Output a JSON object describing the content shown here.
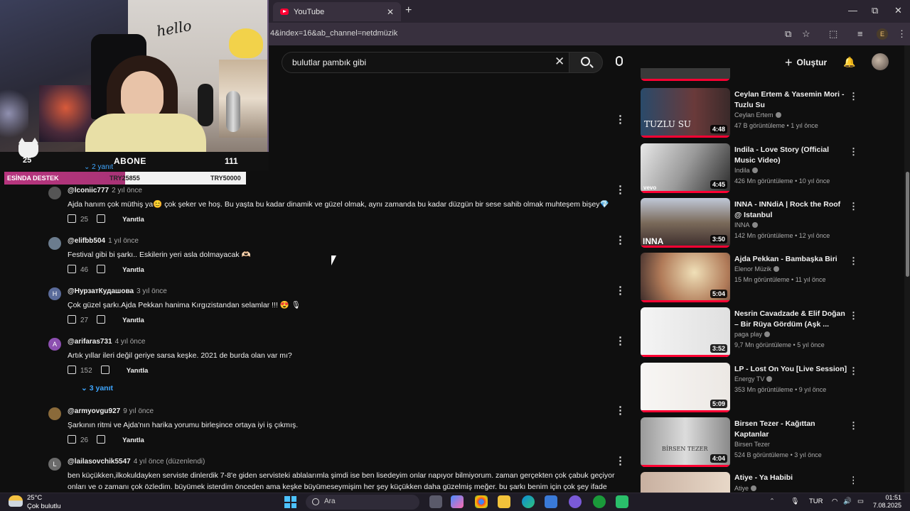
{
  "browser": {
    "tab_title": "YouTube",
    "url": "4&index=16&ab_channel=netdmüzik",
    "profile_initial": "E"
  },
  "youtube": {
    "search_value": "bulutlar pambık gibi",
    "create_label": "Oluştur",
    "reply_label": "Yanıtla"
  },
  "overlay": {
    "cam_text": "hello",
    "sub_count": "25",
    "sub_label": "ABONE",
    "sub_total": "111",
    "donate_label": "ESİNDA DESTEK",
    "donate_current": "TRY25855",
    "donate_goal": "TRY50000",
    "hidden_replies": "2 yanıt"
  },
  "comments": [
    {
      "avatar": "",
      "avatar_color": "#555555",
      "author": "@lconiic777",
      "time": "2 yıl önce",
      "text": "Ajda hanım çok müthiş ya😊  çok şeker ve hoş. Bu yaşta bu kadar dinamik ve güzel olmak, aynı zamanda bu kadar düzgün bir sese sahib olmak muhteşem bişey💎",
      "likes": "25"
    },
    {
      "avatar": "",
      "avatar_color": "#6b7c8e",
      "author": "@elifbb504",
      "time": "1 yıl önce",
      "text": "Festival gibi bi şarkı.. Eskilerin yeri asla dolmayacak 🫶🏻",
      "likes": "46"
    },
    {
      "avatar": "H",
      "avatar_color": "#5a6b9a",
      "author": "@НурзатКудашова",
      "time": "3 yıl önce",
      "text": "Çok güzel şarkı.Ajda Pekkan hanima Kırgızistandan selamlar !!! 😍 🎙",
      "likes": "27"
    },
    {
      "avatar": "A",
      "avatar_color": "#8c4fb0",
      "author": "@arifaras731",
      "time": "4 yıl önce",
      "text": "Artık yıllar ileri değil geriye sarsa keşke. 2021 de burda olan var mı?",
      "likes": "152",
      "replies": "3 yanıt"
    },
    {
      "avatar": "",
      "avatar_color": "#8a6a3a",
      "author": "@armyovgu927",
      "time": "9 yıl önce",
      "text": "Şarkının ritmi ve Ajda'nın harika yorumu birleşince ortaya iyi iş çıkmış.",
      "likes": "26"
    },
    {
      "avatar": "L",
      "avatar_color": "#6b6b6b",
      "author": "@lailasovchik5547",
      "time": "4 yıl önce (düzenlendi)",
      "text": "ben küçükken,ilkokuldayken serviste dinlerdik 7-8'e giden servisteki ablalarımla şimdi ise ben lisedeyim onlar napıyor bilmiyorum. zaman gerçekten çok çabuk geçiyor onları ve o zamanı çok özledim. büyümek isterdim önceden ama keşke büyümeseymişim her şey küçükken daha güzelmiş meğer. bu şarkı benim için çok şey ifade",
      "likes": ""
    }
  ],
  "sidebar": [
    {
      "title": "Ceylan Ertem & Yasemin Mori - Tuzlu Su",
      "channel": "Ceylan Ertem",
      "views": "47 B görüntüleme",
      "age": "1 yıl önce",
      "duration": "4:48",
      "thumb_text": "TUZLU SU",
      "verified": true
    },
    {
      "title": "Indila - Love Story (Official Music Video)",
      "channel": "Indila",
      "views": "426 Mn görüntüleme",
      "age": "10 yıl önce",
      "duration": "4:45",
      "thumb_text": "vevo",
      "verified": true
    },
    {
      "title": "INNA - INNdiA | Rock the Roof @ Istanbul",
      "channel": "INNA",
      "views": "142 Mn görüntüleme",
      "age": "12 yıl önce",
      "duration": "3:50",
      "thumb_text": "INNA",
      "verified": true
    },
    {
      "title": "Ajda Pekkan - Bambaşka Biri",
      "channel": "Elenor Müzik",
      "views": "15 Mn görüntüleme",
      "age": "11 yıl önce",
      "duration": "5:04",
      "thumb_text": "",
      "verified": true
    },
    {
      "title": "Nesrin Cavadzade & Elif Doğan – Bir Rüya Gördüm (Aşk ...",
      "channel": "paga play",
      "views": "9,7 Mn görüntüleme",
      "age": "5 yıl önce",
      "duration": "3:52",
      "thumb_text": "",
      "verified": true
    },
    {
      "title": "LP - Lost On You [Live Session]",
      "channel": "Energy TV",
      "views": "353 Mn görüntüleme",
      "age": "9 yıl önce",
      "duration": "5:09",
      "thumb_text": "",
      "verified": true
    },
    {
      "title": "Birsen Tezer - Kağıttan Kaptanlar",
      "channel": "Birsen Tezer",
      "views": "524 B görüntüleme",
      "age": "3 yıl önce",
      "duration": "4:04",
      "thumb_text": "BİRSEN TEZER",
      "verified": false
    },
    {
      "title": "Atiye - Ya Habibi",
      "channel": "Atiye",
      "views": "",
      "age": "",
      "duration": "",
      "thumb_text": "",
      "verified": true
    }
  ],
  "taskbar": {
    "temp": "25°C",
    "weather": "Çok bulutlu",
    "search_label": "Ara",
    "lang": "TUR",
    "time": "01:51",
    "date": "7.08.2025"
  }
}
